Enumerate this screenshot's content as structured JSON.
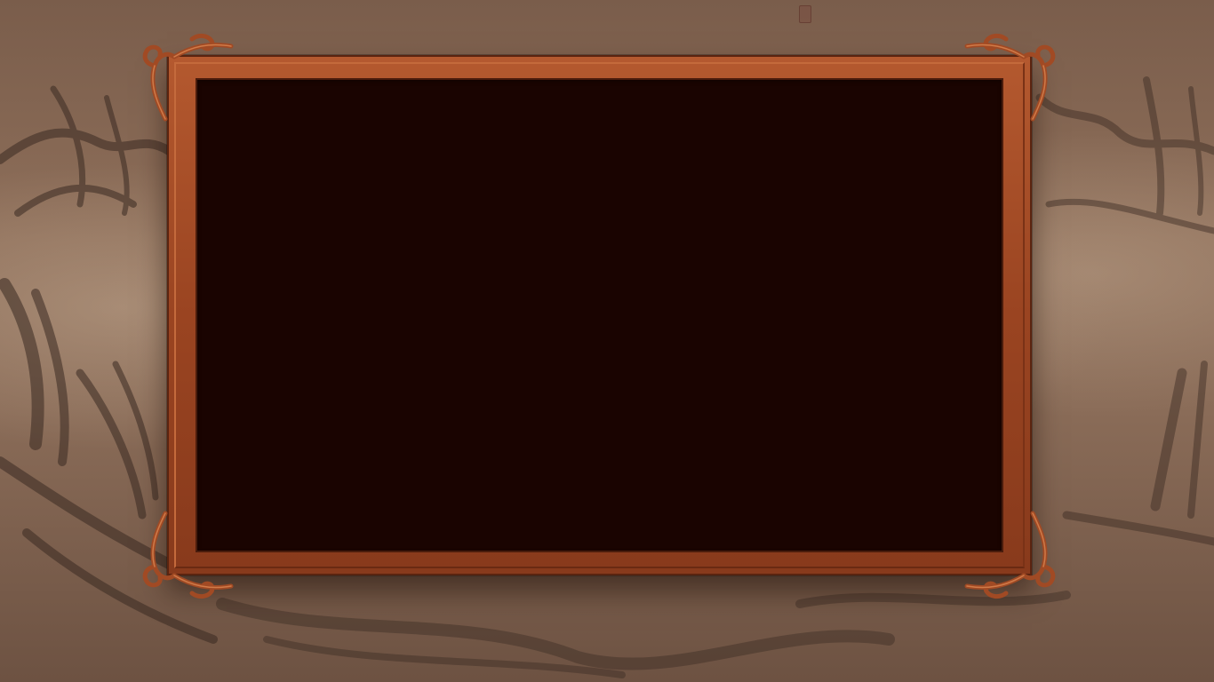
{
  "scene": {
    "name": "ink-landscape-menu-background",
    "frame_color": "#a14a24",
    "frame_highlight": "#c46a3c",
    "panel_color": "#1a0401",
    "background_tone": "#8a6c58"
  },
  "icons": {
    "ornament_top_left": "scroll-ornament-icon",
    "ornament_top_right": "scroll-ornament-icon",
    "ornament_bottom_left": "scroll-ornament-icon",
    "ornament_bottom_right": "scroll-ornament-icon",
    "seal": "seal-stamp-icon"
  }
}
